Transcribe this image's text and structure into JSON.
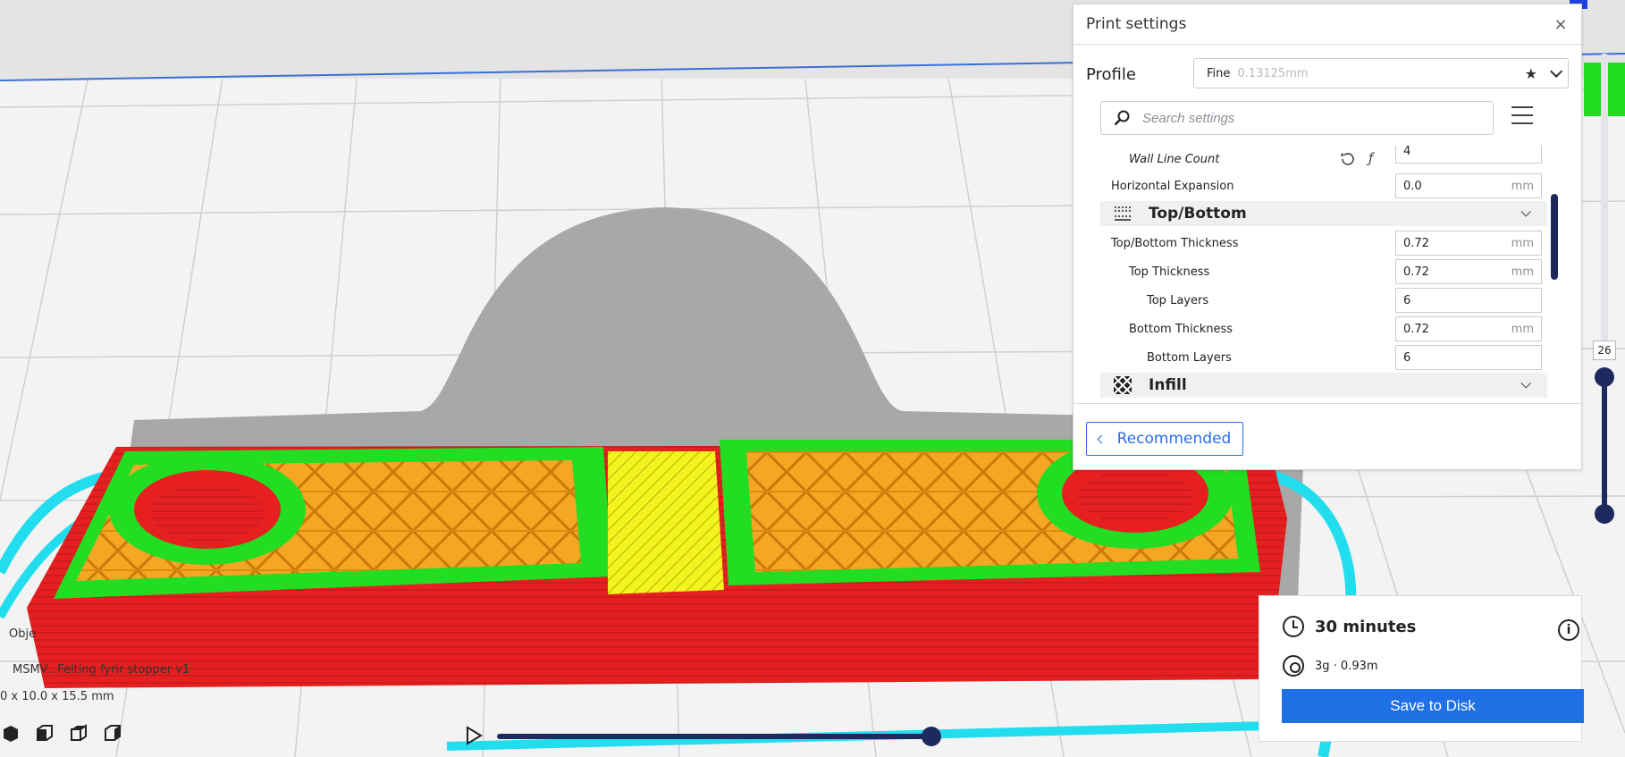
{
  "print_settings": {
    "title": "Print settings",
    "close_glyph": "×",
    "profile_label": "Profile",
    "profile_name": "Fine",
    "profile_sub": "0.13125mm",
    "search_placeholder": "Search settings",
    "settings": {
      "wall_line_count": {
        "label": "Wall Line Count",
        "value": "4"
      },
      "horizontal_expansion": {
        "label": "Horizontal Expansion",
        "value": "0.0",
        "unit": "mm"
      },
      "top_bottom_category": "Top/Bottom",
      "top_bottom_thickness": {
        "label": "Top/Bottom Thickness",
        "value": "0.72",
        "unit": "mm"
      },
      "top_thickness": {
        "label": "Top Thickness",
        "value": "0.72",
        "unit": "mm"
      },
      "top_layers": {
        "label": "Top Layers",
        "value": "6"
      },
      "bottom_thickness": {
        "label": "Bottom Thickness",
        "value": "0.72",
        "unit": "mm"
      },
      "bottom_layers": {
        "label": "Bottom Layers",
        "value": "6"
      },
      "infill_category": "Infill"
    },
    "recommended_label": "Recommended"
  },
  "layer_slider": {
    "current_layer": "26"
  },
  "summary": {
    "time": "30 minutes",
    "material": "3g · 0.93m",
    "save_label": "Save to Disk"
  },
  "object_info": {
    "label": "Obje",
    "name": "MSMV...Felting fyrir stopper v1",
    "dims": "0 x 10.0 x 15.5 mm"
  },
  "colors": {
    "wall_outer": "#e62020",
    "wall_inner": "#22dd22",
    "infill": "#f5a623",
    "top_bottom": "#f3f320",
    "skirt": "#22ddee",
    "accent": "#1f6fe5",
    "slider": "#1e2a5e"
  }
}
